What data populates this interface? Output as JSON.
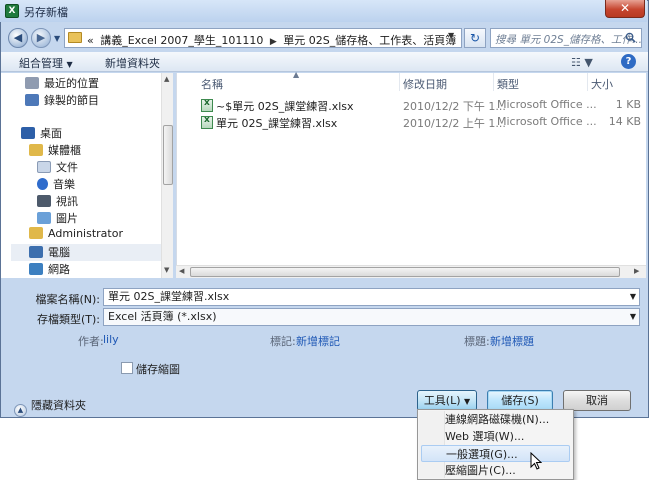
{
  "window": {
    "title": "另存新檔",
    "close_glyph": "✕",
    "app_icon_letter": "X"
  },
  "address": {
    "crumbs": [
      "«",
      "講義_Excel 2007_學生_101110",
      "單元 02S_儲存格、工作表、活頁簿"
    ],
    "search_placeholder": "搜尋 單元 02S_儲存格、工作..."
  },
  "toolbar": {
    "organize_label": "組合管理",
    "new_folder_label": "新增資料夾"
  },
  "nav_pane": {
    "items": [
      {
        "label": "最近的位置",
        "icon": "recent-places-icon",
        "color": "#8f9bb0"
      },
      {
        "label": "錄製的節目",
        "icon": "recorded-tv-icon",
        "color": "#4d78b8"
      },
      {
        "label": "桌面",
        "icon": "desktop-icon",
        "color": "#2d5fa8"
      },
      {
        "label": "媒體櫃",
        "icon": "libraries-icon",
        "color": "#e0b84a"
      },
      {
        "label": "文件",
        "icon": "documents-icon",
        "color": "#c9d6e8"
      },
      {
        "label": "音樂",
        "icon": "music-icon",
        "color": "#2f6ccc"
      },
      {
        "label": "視訊",
        "icon": "video-icon",
        "color": "#4d5a6b"
      },
      {
        "label": "圖片",
        "icon": "pictures-icon",
        "color": "#6aa0d8"
      },
      {
        "label": "Administrator",
        "icon": "user-folder-icon",
        "color": "#e0b84a"
      },
      {
        "label": "電腦",
        "icon": "computer-icon",
        "color": "#3d6fae"
      },
      {
        "label": "網路",
        "icon": "network-icon",
        "color": "#3c7fc0"
      }
    ]
  },
  "file_list": {
    "columns": [
      "名稱",
      "修改日期",
      "類型",
      "大小"
    ],
    "rows": [
      {
        "name": "~$單元 02S_課堂練習.xlsx",
        "date": "2010/12/2 下午 1...",
        "type": "Microsoft Office ...",
        "size": "1 KB"
      },
      {
        "name": "單元 02S_課堂練習.xlsx",
        "date": "2010/12/2 上午 1...",
        "type": "Microsoft Office ...",
        "size": "14 KB"
      }
    ]
  },
  "form": {
    "filename_label": "檔案名稱(N):",
    "filename_value": "單元 02S_課堂練習.xlsx",
    "filetype_label": "存檔類型(T):",
    "filetype_value": "Excel 活頁簿 (*.xlsx)",
    "author_label": "作者:",
    "author_value": "lily",
    "tags_label": "標記:",
    "tags_value": "新增標記",
    "title_label": "標題:",
    "title_value": "新增標題",
    "thumbnail_label": "儲存縮圖"
  },
  "buttons": {
    "hide_folders": "隱藏資料夾",
    "tools": "工具(L)",
    "save": "儲存(S)",
    "cancel": "取消"
  },
  "tools_menu": {
    "items": [
      "連線網路磁碟機(N)...",
      "Web 選項(W)...",
      "一般選項(G)...",
      "壓縮圖片(C)..."
    ],
    "highlighted_index": 2
  }
}
